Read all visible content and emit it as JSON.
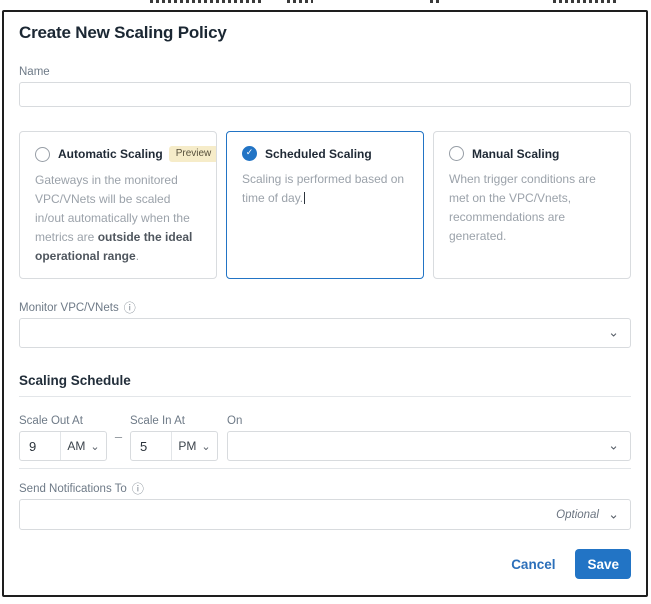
{
  "dialog": {
    "title": "Create New Scaling Policy"
  },
  "fields": {
    "name": {
      "label": "Name",
      "value": ""
    },
    "monitor": {
      "label": "Monitor VPC/VNets",
      "value": ""
    },
    "notifications": {
      "label": "Send Notifications To",
      "placeholder": "Optional"
    }
  },
  "scaling_options": [
    {
      "label": "Automatic Scaling",
      "badge": "Preview",
      "selected": false,
      "description_pre": "Gateways in the monitored VPC/VNets will be scaled in/out automatically when the metrics are ",
      "description_bold": "outside the ideal operational range",
      "description_post": "."
    },
    {
      "label": "Scheduled Scaling",
      "selected": true,
      "description_pre": "Scaling is performed based on time of day.",
      "description_bold": "",
      "description_post": ""
    },
    {
      "label": "Manual Scaling",
      "selected": false,
      "description_pre": "When trigger conditions are met on the VPC/Vnets, recommendations are generated.",
      "description_bold": "",
      "description_post": ""
    }
  ],
  "schedule": {
    "section_title": "Scaling Schedule",
    "scale_out": {
      "label": "Scale Out At",
      "time": "9",
      "meridiem": "AM"
    },
    "range_separator": "–",
    "scale_in": {
      "label": "Scale In At",
      "time": "5",
      "meridiem": "PM"
    },
    "on": {
      "label": "On",
      "value": ""
    }
  },
  "footer": {
    "cancel_label": "Cancel",
    "save_label": "Save"
  },
  "icons": {
    "info": "ⓘ",
    "chevron_down": "⌄",
    "check": "✓"
  },
  "colors": {
    "accent": "#2274c5",
    "accent_link": "#2b6fba",
    "badge_bg": "#f6ecc9",
    "badge_text": "#57503c",
    "selected_radio": "#2274c5"
  }
}
